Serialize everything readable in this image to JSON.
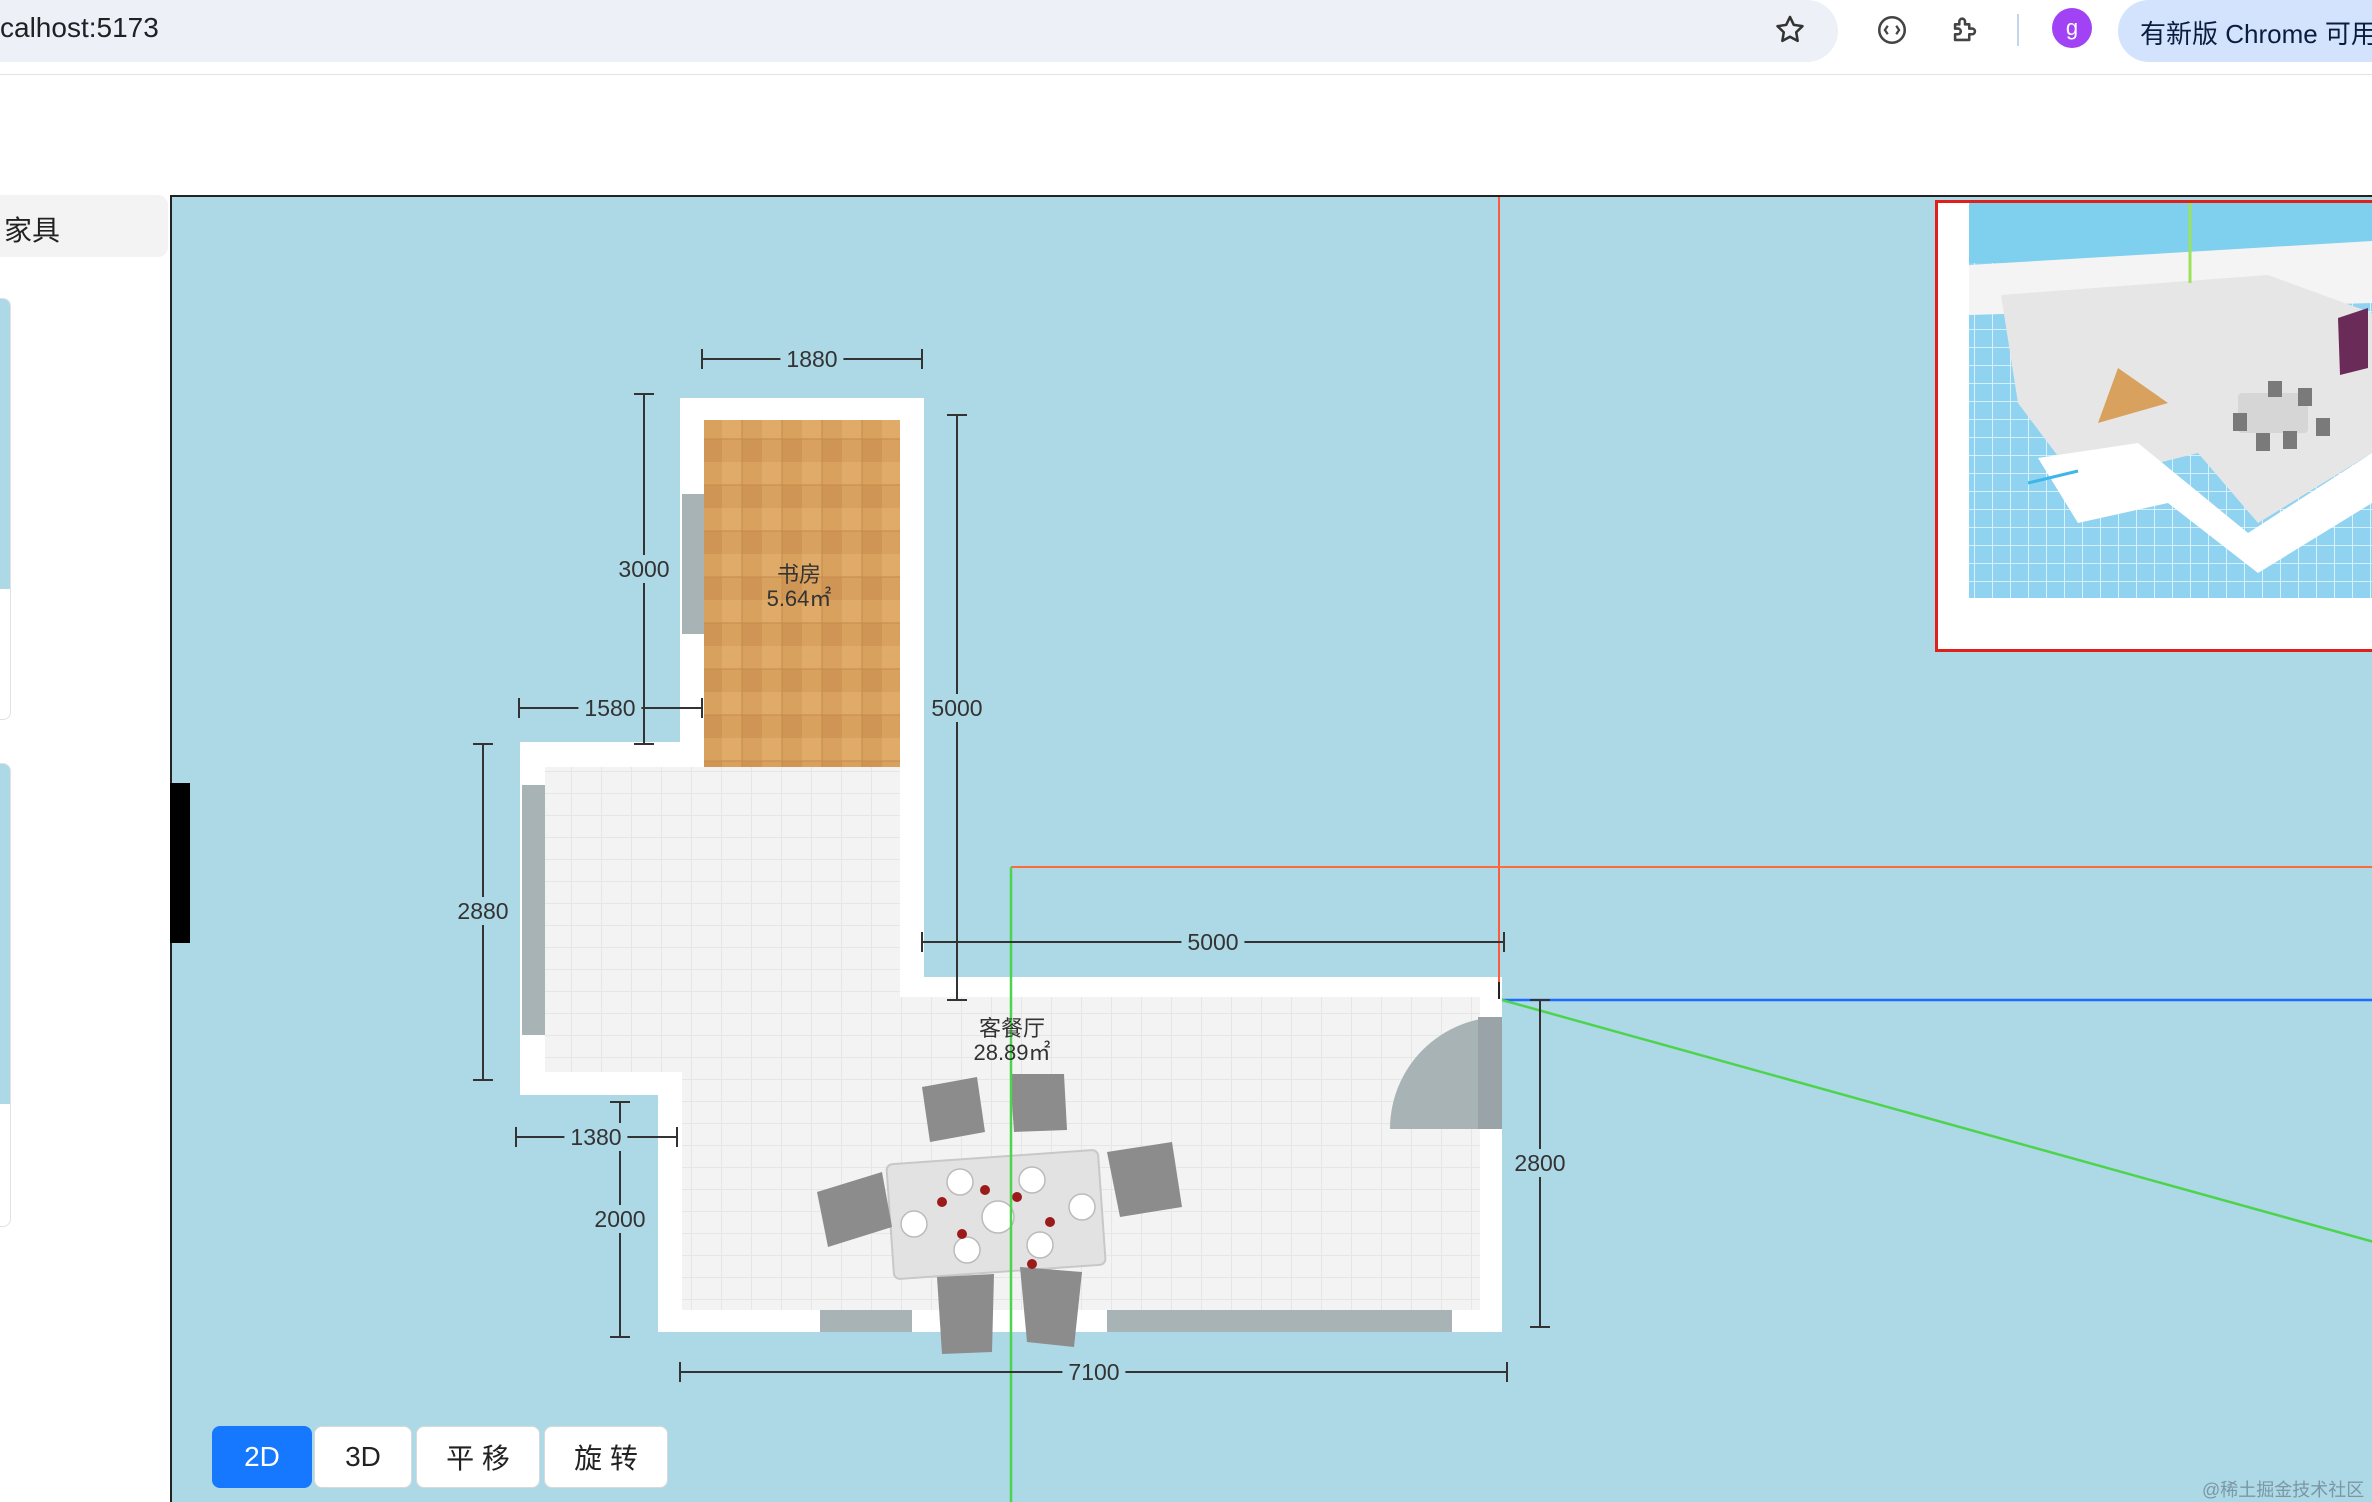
{
  "browser": {
    "url": "calhost:5173",
    "profile_initial": "g",
    "update_text": "有新版 Chrome 可用",
    "icons": [
      "star-icon",
      "extension-circle-icon",
      "puzzle-icon"
    ]
  },
  "sidebar": {
    "tab_label": "家具"
  },
  "floorplan": {
    "rooms": [
      {
        "name": "书房",
        "area": "5.64㎡"
      },
      {
        "name": "客餐厅",
        "area": "28.89㎡"
      }
    ],
    "dimensions": [
      "1880",
      "3000",
      "5000",
      "1580",
      "2880",
      "5000",
      "1380",
      "2000",
      "2800",
      "7100"
    ]
  },
  "view_controls": {
    "buttons": [
      "2D",
      "3D",
      "平 移",
      "旋 转"
    ],
    "active": "2D"
  },
  "watermark": "@稀土掘金技术社区",
  "colors": {
    "canvas_bg": "#add8e6",
    "active_button": "#1677ff",
    "minimap_border": "#e0201b",
    "axis_x": "#1e6bff",
    "axis_y": "#4cd44c",
    "axis_red": "#ff3b3b"
  }
}
